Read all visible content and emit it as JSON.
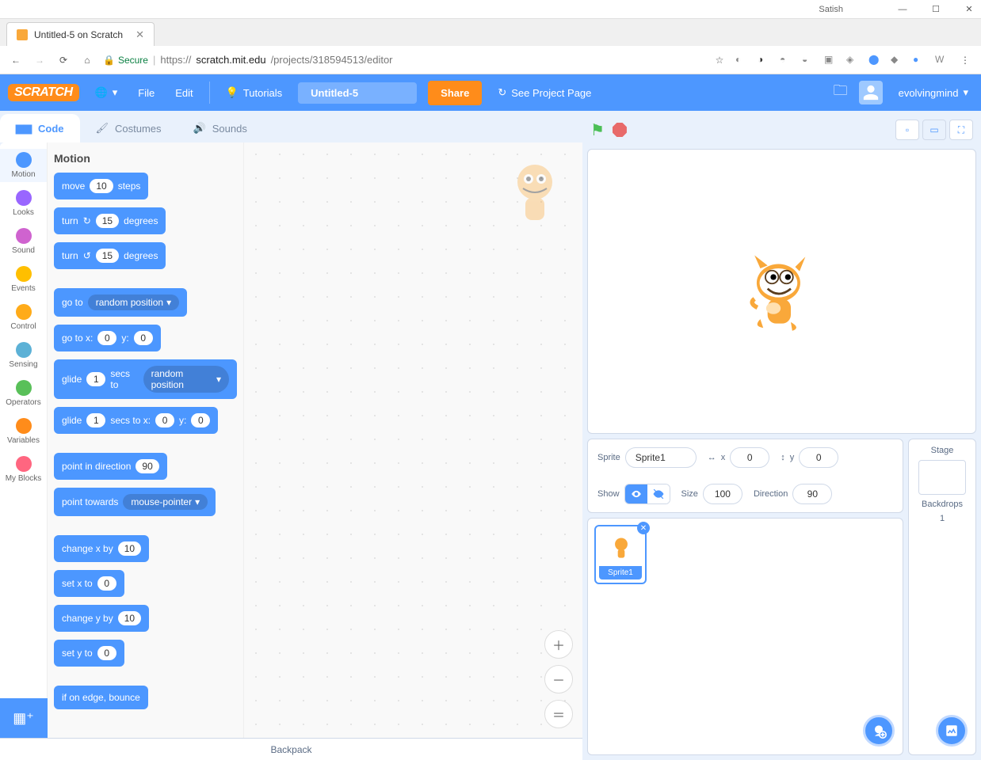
{
  "window": {
    "user": "Satish"
  },
  "browser": {
    "tab_title": "Untitled-5 on Scratch",
    "secure_label": "Secure",
    "url_prefix": "https://",
    "url_domain": "scratch.mit.edu",
    "url_path": "/projects/318594513/editor"
  },
  "menubar": {
    "logo": "SCRATCH",
    "file": "File",
    "edit": "Edit",
    "tutorials": "Tutorials",
    "project_name": "Untitled-5",
    "share": "Share",
    "see_project": "See Project Page",
    "username": "evolvingmind"
  },
  "tabs": {
    "code": "Code",
    "costumes": "Costumes",
    "sounds": "Sounds"
  },
  "categories": [
    {
      "name": "Motion",
      "color": "#4c97ff"
    },
    {
      "name": "Looks",
      "color": "#9966ff"
    },
    {
      "name": "Sound",
      "color": "#cf63cf"
    },
    {
      "name": "Events",
      "color": "#ffbf00"
    },
    {
      "name": "Control",
      "color": "#ffab19"
    },
    {
      "name": "Sensing",
      "color": "#5cb1d6"
    },
    {
      "name": "Operators",
      "color": "#59c059"
    },
    {
      "name": "Variables",
      "color": "#ff8c1a"
    },
    {
      "name": "My Blocks",
      "color": "#ff6680"
    }
  ],
  "palette": {
    "heading": "Motion",
    "blocks": {
      "move": {
        "t1": "move",
        "v": "10",
        "t2": "steps"
      },
      "turn_cw": {
        "t1": "turn",
        "v": "15",
        "t2": "degrees"
      },
      "turn_ccw": {
        "t1": "turn",
        "v": "15",
        "t2": "degrees"
      },
      "goto": {
        "t1": "go to",
        "d": "random position"
      },
      "gotoxy": {
        "t1": "go to x:",
        "x": "0",
        "t2": "y:",
        "y": "0"
      },
      "glide_rand": {
        "t1": "glide",
        "s": "1",
        "t2": "secs to",
        "d": "random position"
      },
      "glide_xy": {
        "t1": "glide",
        "s": "1",
        "t2": "secs to x:",
        "x": "0",
        "t3": "y:",
        "y": "0"
      },
      "point_dir": {
        "t1": "point in direction",
        "v": "90"
      },
      "point_toward": {
        "t1": "point towards",
        "d": "mouse-pointer"
      },
      "change_x": {
        "t1": "change x by",
        "v": "10"
      },
      "set_x": {
        "t1": "set x to",
        "v": "0"
      },
      "change_y": {
        "t1": "change y by",
        "v": "10"
      },
      "set_y": {
        "t1": "set y to",
        "v": "0"
      },
      "bounce": {
        "t1": "if on edge, bounce"
      }
    }
  },
  "sprite_panel": {
    "sprite_label": "Sprite",
    "sprite_name": "Sprite1",
    "x_label": "x",
    "x": "0",
    "y_label": "y",
    "y": "0",
    "show_label": "Show",
    "size_label": "Size",
    "size": "100",
    "direction_label": "Direction",
    "direction": "90"
  },
  "sprite_tile": {
    "name": "Sprite1"
  },
  "stage_panel": {
    "title": "Stage",
    "backdrops_label": "Backdrops",
    "backdrops_count": "1"
  },
  "backpack": "Backpack"
}
